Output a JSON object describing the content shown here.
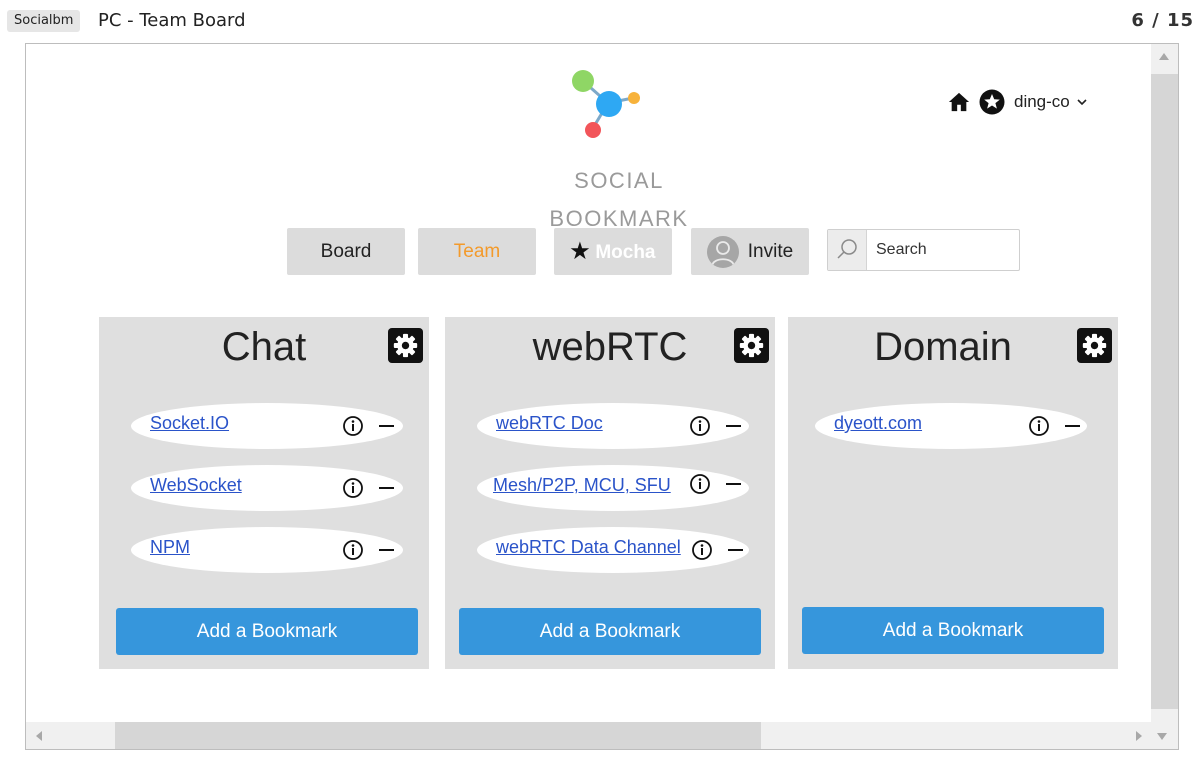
{
  "topbar": {
    "project": "Socialbm",
    "page_title": "PC - Team Board",
    "page_counter": "6 / 15"
  },
  "logo": {
    "line1": "SOCIAL",
    "line2": "BOOKMARK"
  },
  "user": {
    "name": "ding-co"
  },
  "nav": {
    "board": "Board",
    "team": "Team",
    "mocha": "Mocha",
    "invite": "Invite"
  },
  "search": {
    "placeholder": "Search"
  },
  "boards": [
    {
      "title": "Chat",
      "bookmarks": [
        "Socket.IO",
        "WebSocket",
        "NPM"
      ],
      "add_label": "Add a Bookmark"
    },
    {
      "title": "webRTC",
      "bookmarks": [
        "webRTC Doc",
        "Mesh/P2P, MCU, SFU",
        "webRTC Data Channel"
      ],
      "add_label": "Add a Bookmark"
    },
    {
      "title": "Domain",
      "bookmarks": [
        "dyeott.com"
      ],
      "add_label": "Add a Bookmark"
    }
  ],
  "colors": {
    "accent_blue": "#3696dc",
    "team_orange": "#f39a2b",
    "link_blue": "#2a53c9",
    "panel_gray": "#dfdfdf"
  }
}
